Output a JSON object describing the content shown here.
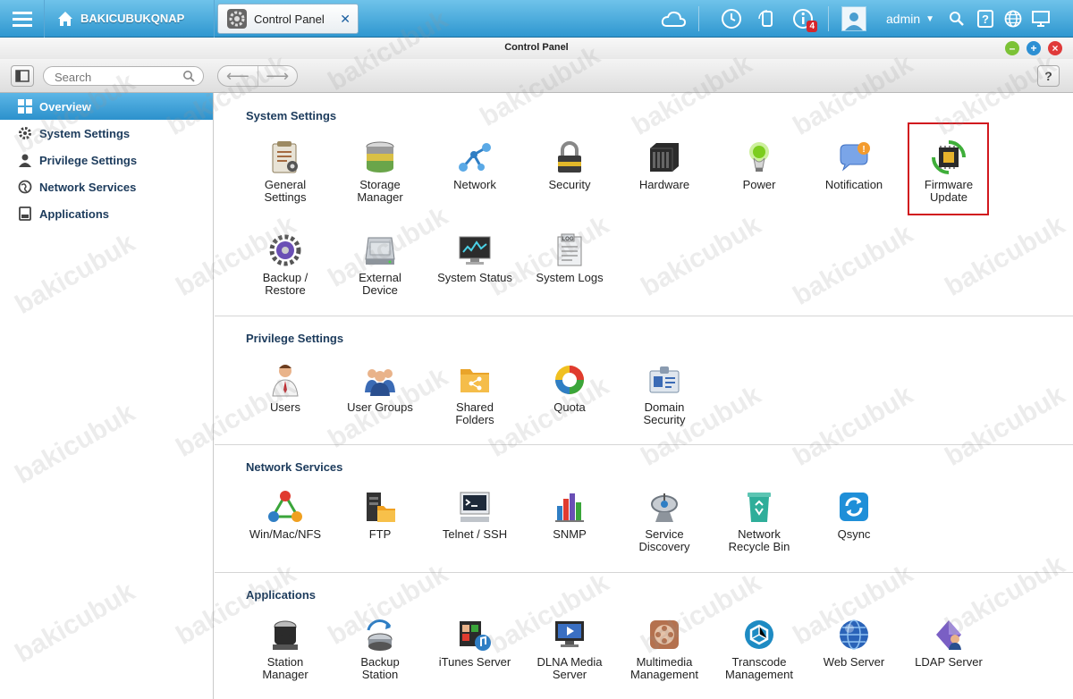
{
  "topbar": {
    "home_label": "BAKICUBUKQNAP",
    "tab_label": "Control Panel",
    "notification_count": "4",
    "user_label": "admin"
  },
  "window": {
    "title": "Control Panel"
  },
  "toolbar": {
    "search_placeholder": "Search",
    "help_label": "?"
  },
  "sidebar": {
    "items": [
      {
        "label": "Overview",
        "icon": "grid-icon",
        "active": true
      },
      {
        "label": "System Settings",
        "icon": "gear-icon"
      },
      {
        "label": "Privilege Settings",
        "icon": "user-icon"
      },
      {
        "label": "Network Services",
        "icon": "globe-icon"
      },
      {
        "label": "Applications",
        "icon": "app-icon"
      }
    ]
  },
  "sections": {
    "system": {
      "title": "System Settings",
      "items": [
        {
          "label": "General\nSettings",
          "icon": "general-settings-icon"
        },
        {
          "label": "Storage\nManager",
          "icon": "storage-manager-icon"
        },
        {
          "label": "Network",
          "icon": "network-icon"
        },
        {
          "label": "Security",
          "icon": "lock-icon"
        },
        {
          "label": "Hardware",
          "icon": "hardware-icon"
        },
        {
          "label": "Power",
          "icon": "power-bulb-icon"
        },
        {
          "label": "Notification",
          "icon": "notification-icon"
        },
        {
          "label": "Firmware\nUpdate",
          "icon": "firmware-chip-icon"
        },
        {
          "label": "Backup /\nRestore",
          "icon": "backup-restore-icon"
        },
        {
          "label": "External\nDevice",
          "icon": "external-device-icon"
        },
        {
          "label": "System Status",
          "icon": "monitor-icon"
        },
        {
          "label": "System Logs",
          "icon": "log-icon"
        }
      ]
    },
    "privilege": {
      "title": "Privilege Settings",
      "items": [
        {
          "label": "Users",
          "icon": "user-icon"
        },
        {
          "label": "User Groups",
          "icon": "user-group-icon"
        },
        {
          "label": "Shared\nFolders",
          "icon": "shared-folder-icon"
        },
        {
          "label": "Quota",
          "icon": "quota-pie-icon"
        },
        {
          "label": "Domain\nSecurity",
          "icon": "id-card-icon"
        }
      ]
    },
    "network": {
      "title": "Network Services",
      "items": [
        {
          "label": "Win/Mac/NFS",
          "icon": "file-protocol-icon"
        },
        {
          "label": "FTP",
          "icon": "ftp-icon"
        },
        {
          "label": "Telnet / SSH",
          "icon": "terminal-icon"
        },
        {
          "label": "SNMP",
          "icon": "bar-chart-icon"
        },
        {
          "label": "Service\nDiscovery",
          "icon": "satellite-dish-icon"
        },
        {
          "label": "Network\nRecycle Bin",
          "icon": "recycle-bin-icon"
        },
        {
          "label": "Qsync",
          "icon": "sync-icon"
        }
      ]
    },
    "applications": {
      "title": "Applications",
      "items": [
        {
          "label": "Station\nManager",
          "icon": "station-manager-icon"
        },
        {
          "label": "Backup\nStation",
          "icon": "backup-station-icon"
        },
        {
          "label": "iTunes Server",
          "icon": "itunes-icon"
        },
        {
          "label": "DLNA Media\nServer",
          "icon": "media-player-icon"
        },
        {
          "label": "Multimedia\nManagement",
          "icon": "film-reel-icon"
        },
        {
          "label": "Transcode\nManagement",
          "icon": "transcode-icon"
        },
        {
          "label": "Web Server",
          "icon": "web-globe-icon"
        },
        {
          "label": "LDAP Server",
          "icon": "ldap-icon"
        }
      ]
    }
  },
  "watermark": "bakicubuk",
  "colors": {
    "topbar": "#2f97d0",
    "active_sidebar": "#2c91cc",
    "section_title": "#1c3b5c",
    "highlight_box": "#d1181e"
  }
}
